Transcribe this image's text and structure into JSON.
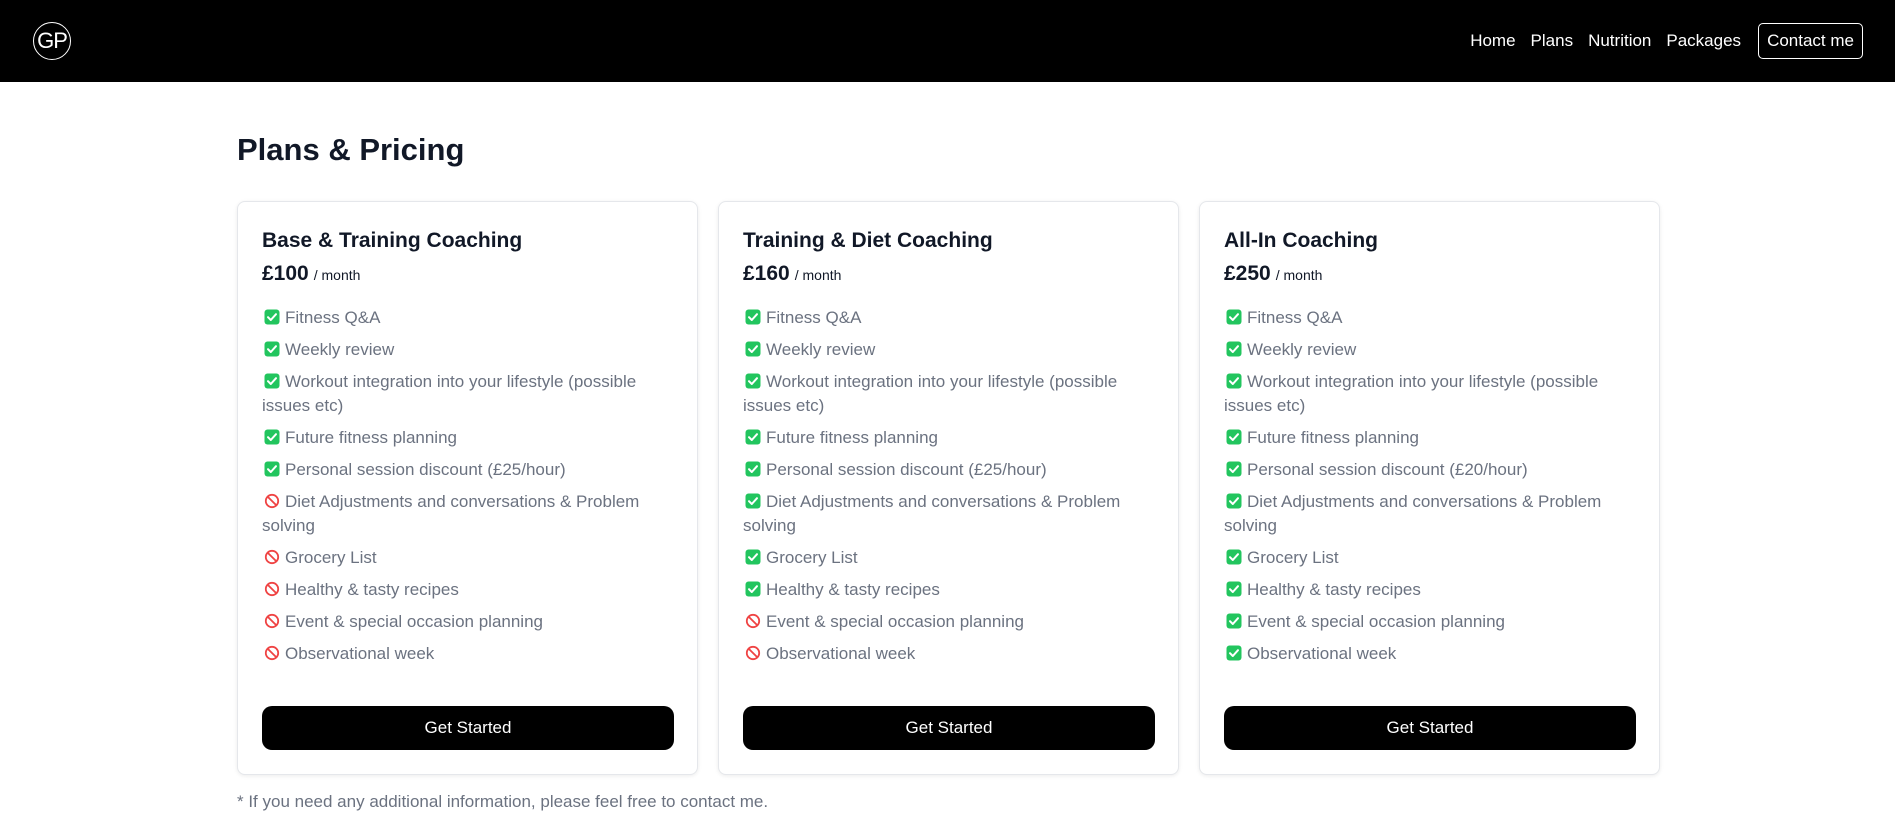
{
  "brand": {
    "logo_text": "GP"
  },
  "nav": {
    "links": [
      "Home",
      "Plans",
      "Nutrition",
      "Packages"
    ],
    "contact": "Contact me"
  },
  "page": {
    "title": "Plans & Pricing"
  },
  "colors": {
    "check": "#22c55e",
    "cross": "#ef4444",
    "button": "#000000"
  },
  "plans": [
    {
      "title": "Base & Training Coaching",
      "price": "£100",
      "period": "/ month",
      "cta": "Get Started",
      "features": [
        {
          "text": "Fitness Q&A",
          "included": true
        },
        {
          "text": "Weekly review",
          "included": true
        },
        {
          "text": "Workout integration into your lifestyle (possible issues etc)",
          "included": true
        },
        {
          "text": "Future fitness planning",
          "included": true
        },
        {
          "text": "Personal session discount (£25/hour)",
          "included": true
        },
        {
          "text": "Diet Adjustments and conversations & Problem solving",
          "included": false
        },
        {
          "text": "Grocery List",
          "included": false
        },
        {
          "text": "Healthy & tasty recipes",
          "included": false
        },
        {
          "text": "Event & special occasion planning",
          "included": false
        },
        {
          "text": "Observational week",
          "included": false
        }
      ]
    },
    {
      "title": "Training & Diet Coaching",
      "price": "£160",
      "period": "/ month",
      "cta": "Get Started",
      "features": [
        {
          "text": "Fitness Q&A",
          "included": true
        },
        {
          "text": "Weekly review",
          "included": true
        },
        {
          "text": "Workout integration into your lifestyle (possible issues etc)",
          "included": true
        },
        {
          "text": "Future fitness planning",
          "included": true
        },
        {
          "text": "Personal session discount (£25/hour)",
          "included": true
        },
        {
          "text": "Diet Adjustments and conversations & Problem solving",
          "included": true
        },
        {
          "text": "Grocery List",
          "included": true
        },
        {
          "text": "Healthy & tasty recipes",
          "included": true
        },
        {
          "text": "Event & special occasion planning",
          "included": false
        },
        {
          "text": "Observational week",
          "included": false
        }
      ]
    },
    {
      "title": "All-In Coaching",
      "price": "£250",
      "period": "/ month",
      "cta": "Get Started",
      "features": [
        {
          "text": "Fitness Q&A",
          "included": true
        },
        {
          "text": "Weekly review",
          "included": true
        },
        {
          "text": "Workout integration into your lifestyle (possible issues etc)",
          "included": true
        },
        {
          "text": "Future fitness planning",
          "included": true
        },
        {
          "text": "Personal session discount (£20/hour)",
          "included": true
        },
        {
          "text": "Diet Adjustments and conversations & Problem solving",
          "included": true
        },
        {
          "text": "Grocery List",
          "included": true
        },
        {
          "text": "Healthy & tasty recipes",
          "included": true
        },
        {
          "text": "Event & special occasion planning",
          "included": true
        },
        {
          "text": "Observational week",
          "included": true
        }
      ]
    }
  ],
  "footnote": "* If you need any additional information, please feel free to contact me."
}
